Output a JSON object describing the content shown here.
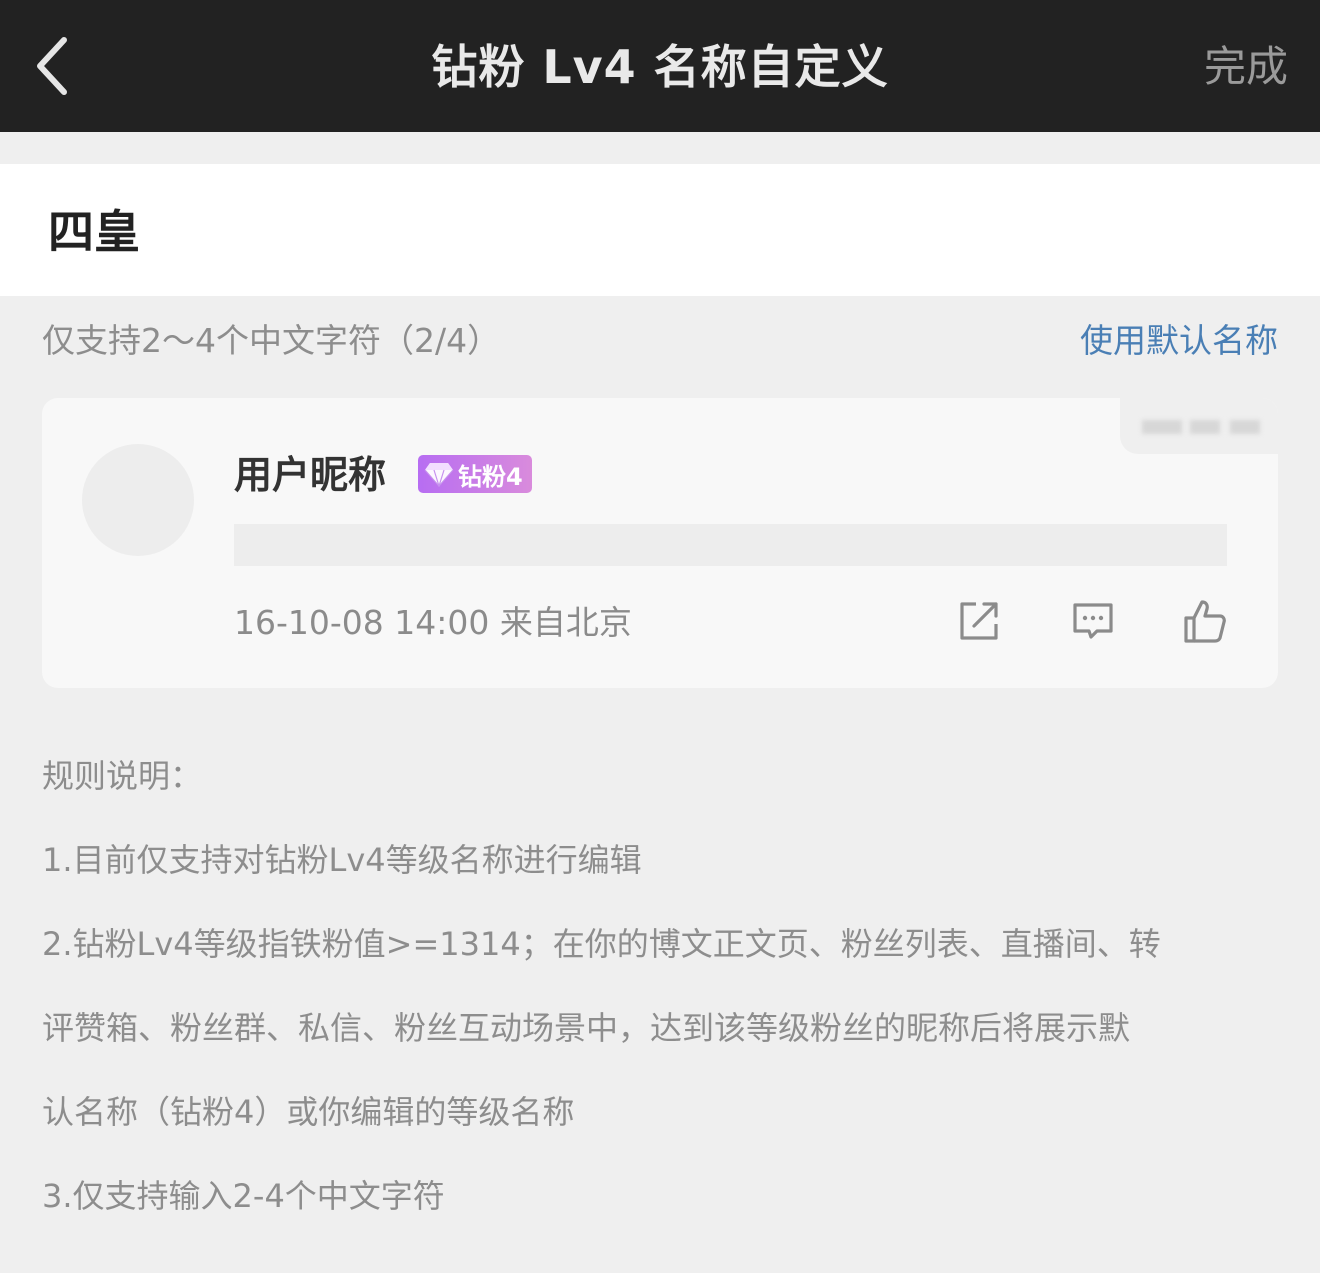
{
  "navbar": {
    "back_icon": "chevron-left-icon",
    "title": "钻粉 Lv4 名称自定义",
    "done_label": "完成"
  },
  "name_input": {
    "value": "四皇"
  },
  "hint": {
    "text": "仅支持2～4个中文字符（2/4）",
    "default_link": "使用默认名称"
  },
  "preview_card": {
    "nickname": "用户昵称",
    "badge_label": "钻粉4",
    "badge_icon": "diamond-icon",
    "meta": "16-10-08 14:00 来自北京",
    "actions": [
      {
        "icon": "share-icon"
      },
      {
        "icon": "comment-icon"
      },
      {
        "icon": "like-icon"
      }
    ],
    "colors": {
      "badge_start": "#b76df2",
      "badge_end": "#d98bdc"
    }
  },
  "rules": {
    "title": "规则说明：",
    "lines": [
      "1.目前仅支持对钻粉Lv4等级名称进行编辑",
      "2.钻粉Lv4等级指铁粉值>=1314；在你的博文正文页、粉丝列表、直播间、转",
      "评赞箱、粉丝群、私信、粉丝互动场景中，达到该等级粉丝的昵称后将展示默",
      "认名称（钻粉4）或你编辑的等级名称",
      "3.仅支持输入2-4个中文字符"
    ]
  },
  "colors": {
    "navbar_bg": "#222222",
    "link": "#4a7fb5",
    "page_bg": "#efefef"
  }
}
